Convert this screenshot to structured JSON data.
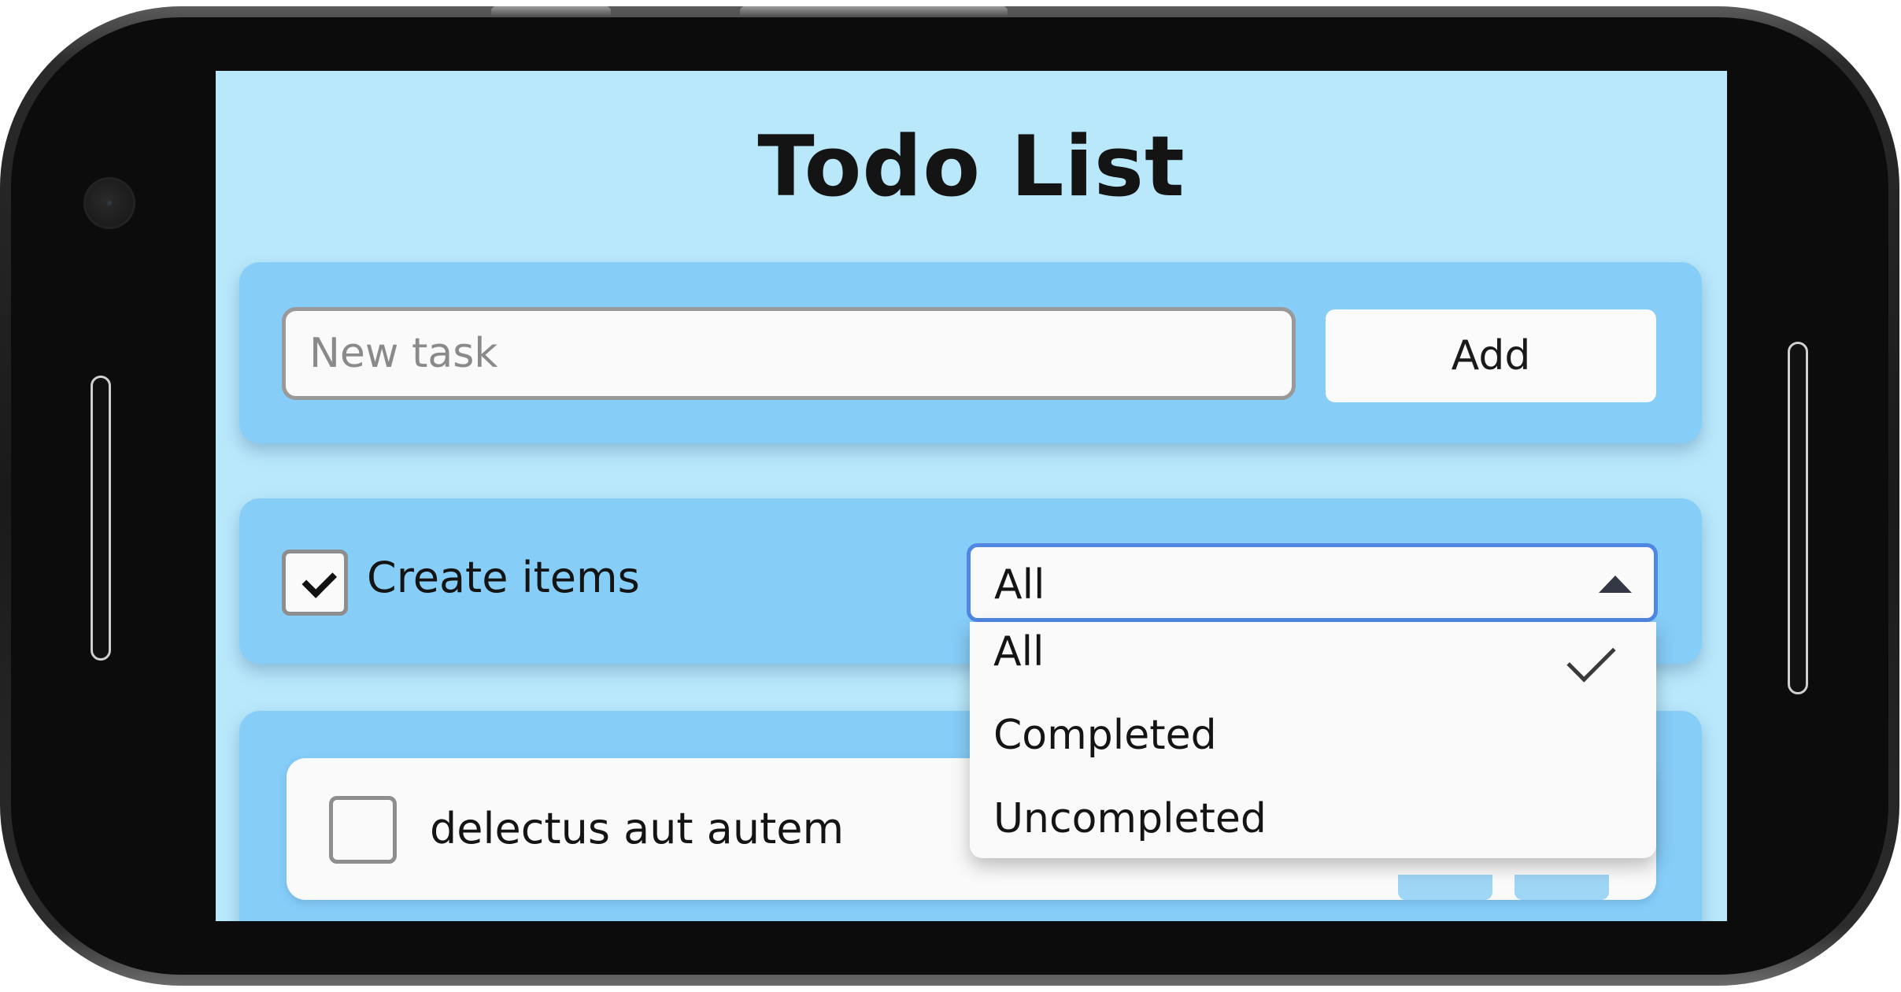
{
  "app": {
    "title": "Todo List"
  },
  "add_panel": {
    "input_placeholder": "New task",
    "input_value": "",
    "add_label": "Add"
  },
  "filter_panel": {
    "create_items_label": "Create items",
    "create_items_checked": true,
    "filter_selected": "All",
    "filter_open": true,
    "filter_options": [
      {
        "label": "All",
        "selected": true
      },
      {
        "label": "Completed",
        "selected": false
      },
      {
        "label": "Uncompleted",
        "selected": false
      }
    ]
  },
  "tasks": [
    {
      "label": "delectus aut autem",
      "completed": false
    }
  ],
  "colors": {
    "screen_bg": "#b9e8fb",
    "panel_bg": "#86cdf8",
    "select_focus_border": "#4f87e3"
  },
  "icons": {
    "checkmark": "check-icon",
    "dropdown_caret": "caret-up-icon"
  }
}
